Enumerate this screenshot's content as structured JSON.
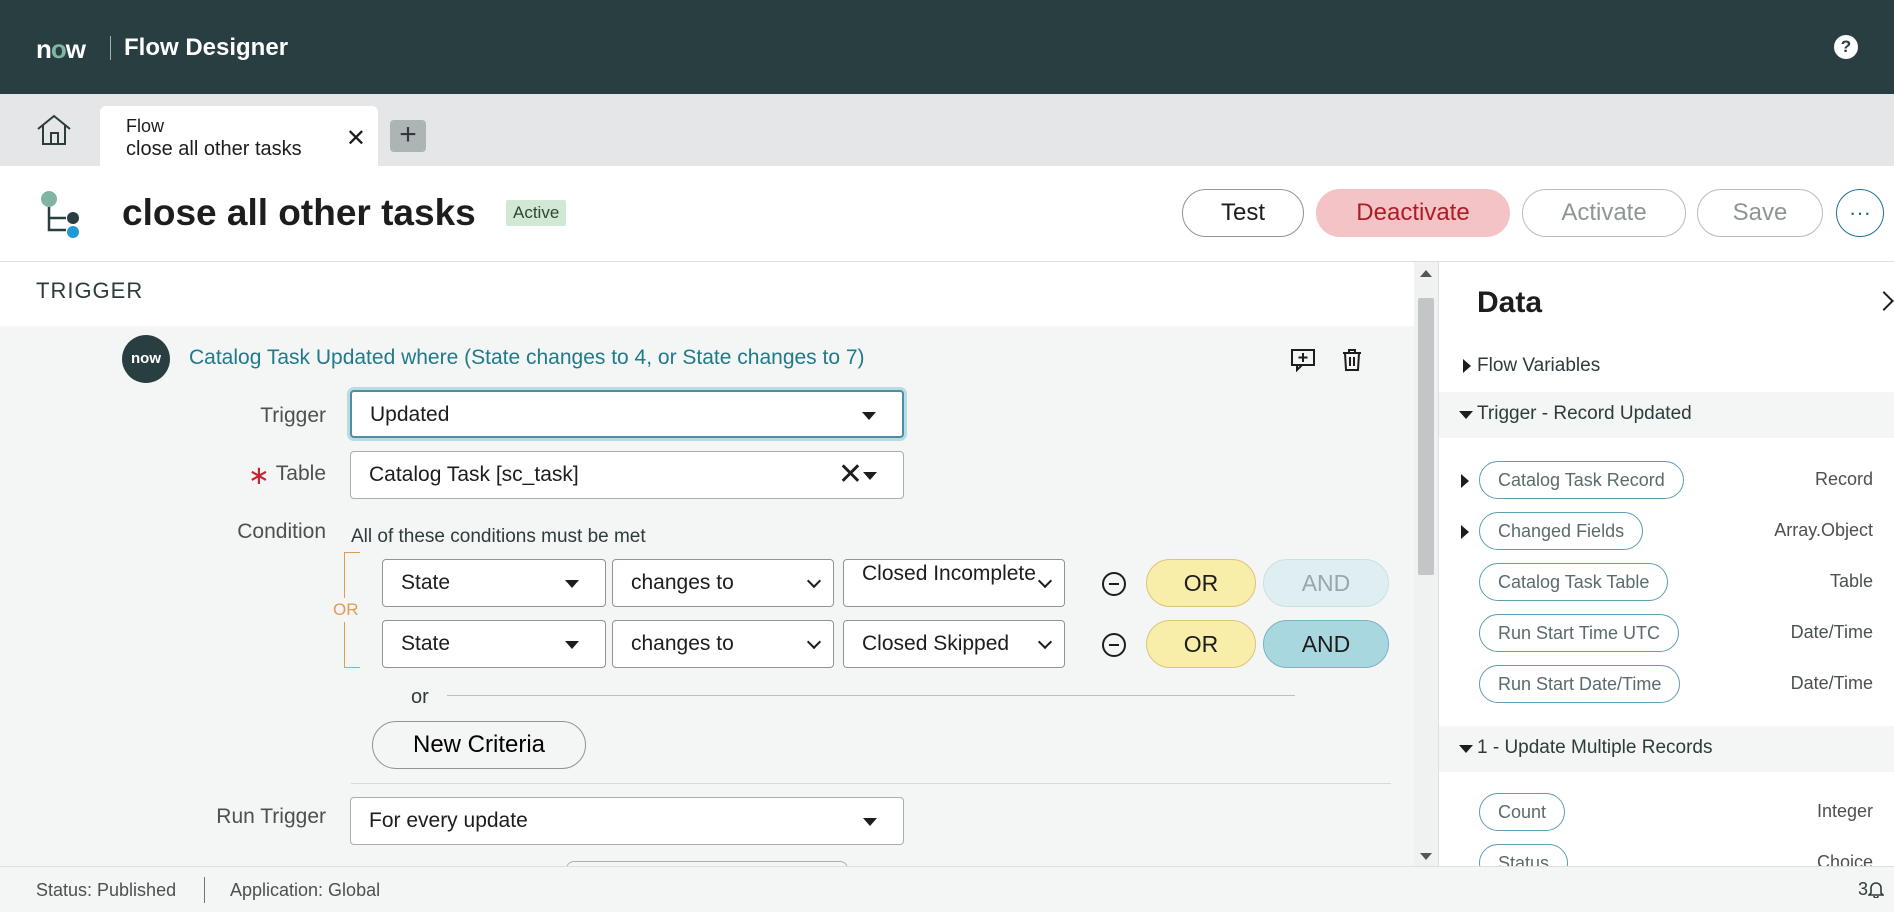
{
  "topbar": {
    "logo_n": "n",
    "logo_o": "o",
    "logo_w": "w",
    "title": "Flow Designer",
    "help_label": "?"
  },
  "tabs": {
    "active": {
      "type": "Flow",
      "name": "close all other tasks",
      "close": "✕"
    },
    "add": "+"
  },
  "header": {
    "title": "close all other tasks",
    "status": "Active",
    "buttons": {
      "test": "Test",
      "deactivate": "Deactivate",
      "activate": "Activate",
      "save": "Save",
      "more": "···"
    }
  },
  "trigger": {
    "section_heading": "TRIGGER",
    "badge": "now",
    "summary": "Catalog Task Updated where (State changes to 4, or State changes to 7)",
    "fields": {
      "trigger_label": "Trigger",
      "trigger_value": "Updated",
      "table_label": "Table",
      "table_required": "∗",
      "table_value": "Catalog Task [sc_task]",
      "table_clear": "✕",
      "condition_label": "Condition",
      "run_trigger_label": "Run Trigger",
      "run_trigger_value": "For every update"
    },
    "condition": {
      "header": "All of these conditions must be met",
      "or_bracket_label": "OR",
      "rows": [
        {
          "field": "State",
          "operator": "changes to",
          "value": "Closed Incomplete",
          "or_label": "OR",
          "and_label": "AND",
          "and_enabled": false
        },
        {
          "field": "State",
          "operator": "changes to",
          "value": "Closed Skipped",
          "or_label": "OR",
          "and_label": "AND",
          "and_enabled": true
        }
      ],
      "or_divider": "or",
      "new_criteria": "New Criteria"
    }
  },
  "data_panel": {
    "title": "Data",
    "sections": [
      {
        "label": "Flow Variables",
        "expanded": false
      },
      {
        "label": "Trigger - Record Updated",
        "expanded": true
      },
      {
        "label": "1 - Update Multiple Records",
        "expanded": true
      }
    ],
    "trigger_items": [
      {
        "label": "Catalog Task Record",
        "type": "Record",
        "expandable": true
      },
      {
        "label": "Changed Fields",
        "type": "Array.Object",
        "expandable": true
      },
      {
        "label": "Catalog Task Table",
        "type": "Table",
        "expandable": false
      },
      {
        "label": "Run Start Time UTC",
        "type": "Date/Time",
        "expandable": false
      },
      {
        "label": "Run Start Date/Time",
        "type": "Date/Time",
        "expandable": false
      }
    ],
    "update_items": [
      {
        "label": "Count",
        "type": "Integer"
      },
      {
        "label": "Status",
        "type": "Choice"
      }
    ]
  },
  "statusbar": {
    "status": "Status: Published",
    "application": "Application: Global",
    "notifications": "3"
  },
  "colors": {
    "topbar": "#293e40",
    "accent_link": "#1f7a8c",
    "deactivate_bg": "#f3c3c6",
    "deactivate_text": "#b01c25",
    "or_pill": "#f8eda9",
    "and_pill": "#a9d7e0",
    "or_bracket": "#e19b54"
  }
}
